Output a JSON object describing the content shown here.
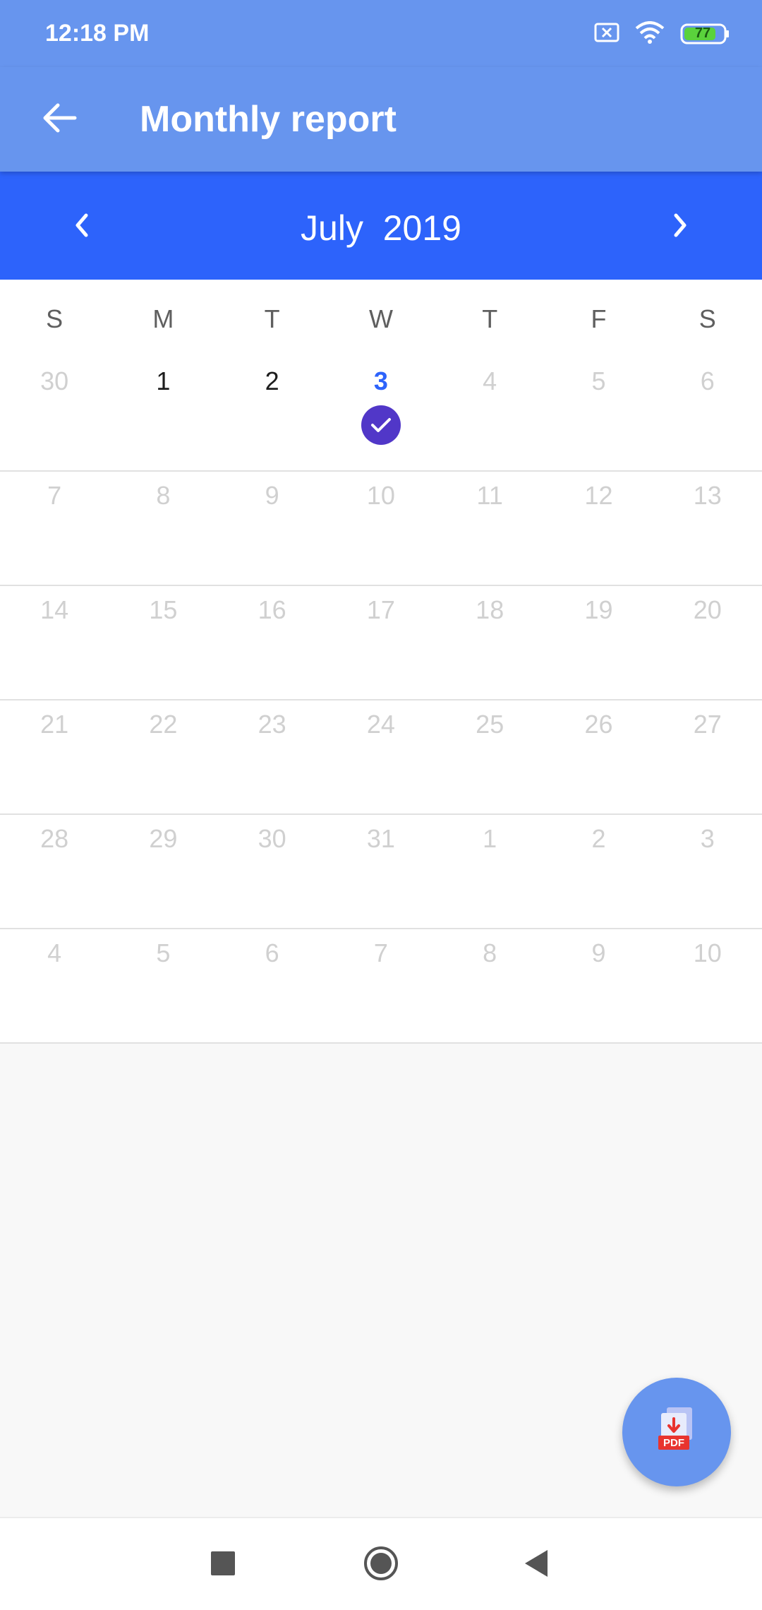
{
  "status_bar": {
    "time": "12:18 PM",
    "battery": "77",
    "icons": [
      "sim-blocked-icon",
      "wifi-icon",
      "battery-icon"
    ]
  },
  "app_bar": {
    "title": "Monthly report",
    "back_icon": "arrow-left-icon"
  },
  "month_bar": {
    "label": "July  2019",
    "prev_icon": "chevron-left-icon",
    "next_icon": "chevron-right-icon"
  },
  "calendar": {
    "weekdays": [
      "S",
      "M",
      "T",
      "W",
      "T",
      "F",
      "S"
    ],
    "weeks": [
      [
        {
          "d": "30",
          "in_month": false
        },
        {
          "d": "1",
          "in_month": true
        },
        {
          "d": "2",
          "in_month": true
        },
        {
          "d": "3",
          "in_month": true,
          "today": true,
          "checked": true
        },
        {
          "d": "4",
          "in_month": false
        },
        {
          "d": "5",
          "in_month": false
        },
        {
          "d": "6",
          "in_month": false
        }
      ],
      [
        {
          "d": "7"
        },
        {
          "d": "8"
        },
        {
          "d": "9"
        },
        {
          "d": "10"
        },
        {
          "d": "11"
        },
        {
          "d": "12"
        },
        {
          "d": "13"
        }
      ],
      [
        {
          "d": "14"
        },
        {
          "d": "15"
        },
        {
          "d": "16"
        },
        {
          "d": "17"
        },
        {
          "d": "18"
        },
        {
          "d": "19"
        },
        {
          "d": "20"
        }
      ],
      [
        {
          "d": "21"
        },
        {
          "d": "22"
        },
        {
          "d": "23"
        },
        {
          "d": "24"
        },
        {
          "d": "25"
        },
        {
          "d": "26"
        },
        {
          "d": "27"
        }
      ],
      [
        {
          "d": "28"
        },
        {
          "d": "29"
        },
        {
          "d": "30"
        },
        {
          "d": "31"
        },
        {
          "d": "1"
        },
        {
          "d": "2"
        },
        {
          "d": "3"
        }
      ],
      [
        {
          "d": "4"
        },
        {
          "d": "5"
        },
        {
          "d": "6"
        },
        {
          "d": "7"
        },
        {
          "d": "8"
        },
        {
          "d": "9"
        },
        {
          "d": "10"
        }
      ]
    ]
  },
  "fab": {
    "icon": "pdf-download-icon",
    "badge": "PDF"
  },
  "nav_bar": {
    "icons": [
      "recents-square-icon",
      "home-circle-icon",
      "back-triangle-icon"
    ]
  },
  "colors": {
    "app_bar": "#6795ee",
    "month_bar": "#2d63fb",
    "today_text": "#2d63fb",
    "check_dot": "#5137c8",
    "faded_day": "#d0d0d0"
  }
}
